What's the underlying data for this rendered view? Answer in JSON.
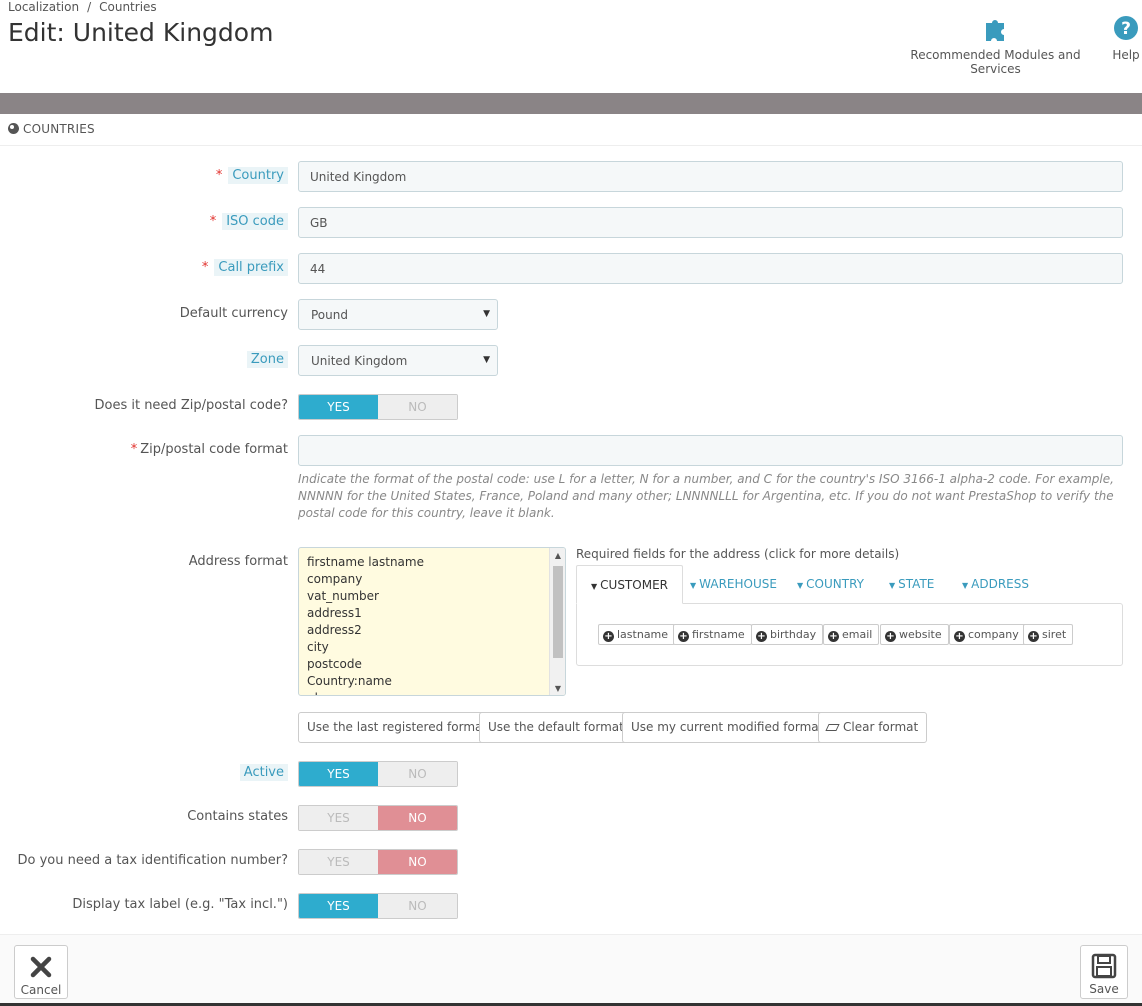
{
  "breadcrumb": {
    "section": "Localization",
    "sep": "/",
    "current": "Countries"
  },
  "page_title": "Edit: United Kingdom",
  "toolbar": {
    "modules_label": "Recommended Modules and Services",
    "help_label": "Help"
  },
  "panel": {
    "title": "COUNTRIES"
  },
  "form": {
    "country": {
      "label": "Country",
      "value": "United Kingdom"
    },
    "iso": {
      "label": "ISO code",
      "value": "GB"
    },
    "call_prefix": {
      "label": "Call prefix",
      "value": "44"
    },
    "currency": {
      "label": "Default currency",
      "value": "Pound"
    },
    "zone": {
      "label": "Zone",
      "value": "United Kingdom"
    },
    "need_zip": {
      "label": "Does it need Zip/postal code?",
      "yes": "YES",
      "no": "NO",
      "value": "YES"
    },
    "zip_format": {
      "label": "Zip/postal code format",
      "value": "",
      "help": "Indicate the format of the postal code: use L for a letter, N for a number, and C for the country's ISO 3166-1 alpha-2 code. For example, NNNNN for the United States, France, Poland and many other; LNNNNLLL for Argentina, etc. If you do not want PrestaShop to verify the postal code for this country, leave it blank."
    },
    "address_format": {
      "label": "Address format",
      "lines": [
        "firstname lastname",
        "company",
        "vat_number",
        "address1",
        "address2",
        "city",
        "postcode",
        "Country:name",
        "phone"
      ]
    },
    "required_fields": {
      "title": "Required fields for the address (click for more details)",
      "tabs": [
        "CUSTOMER",
        "WAREHOUSE",
        "COUNTRY",
        "STATE",
        "ADDRESS"
      ],
      "active_tab": "CUSTOMER",
      "chips": [
        "lastname",
        "firstname",
        "birthday",
        "email",
        "website",
        "company",
        "siret"
      ]
    },
    "format_buttons": {
      "last_registered": "Use the last registered format",
      "default": "Use the default format",
      "current_modified": "Use my current modified format",
      "clear": "Clear format"
    },
    "active": {
      "label": "Active",
      "yes": "YES",
      "no": "NO",
      "value": "YES"
    },
    "contains_states": {
      "label": "Contains states",
      "yes": "YES",
      "no": "NO",
      "value": "NO"
    },
    "need_tax_id": {
      "label": "Do you need a tax identification number?",
      "yes": "YES",
      "no": "NO",
      "value": "NO"
    },
    "display_tax_label": {
      "label": "Display tax label (e.g. \"Tax incl.\")",
      "yes": "YES",
      "no": "NO",
      "value": "YES"
    }
  },
  "footer": {
    "cancel_label": "Cancel",
    "save_label": "Save"
  },
  "colors": {
    "accent": "#2eacce",
    "no_active": "#e08f95",
    "required": "#e2312d",
    "band": "#8a8486"
  }
}
